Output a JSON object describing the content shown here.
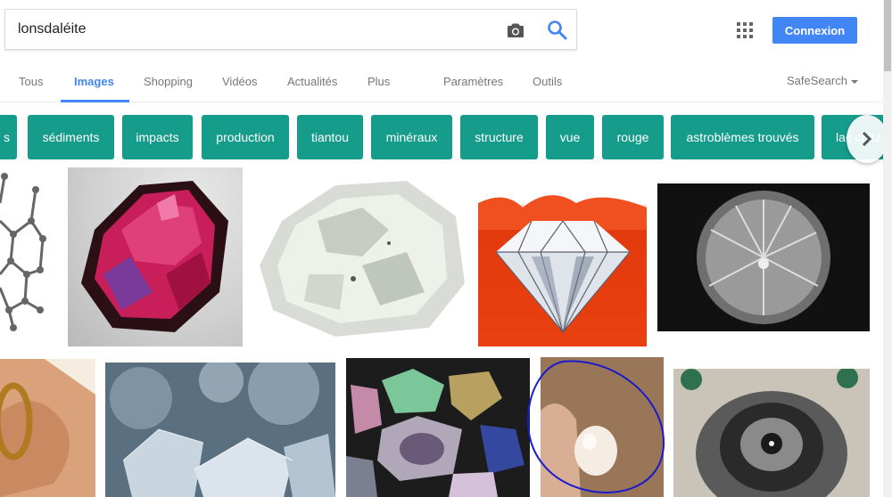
{
  "search": {
    "query": "lonsdaléite"
  },
  "header": {
    "signin_label": "Connexion"
  },
  "tabs": [
    {
      "label": "Tous"
    },
    {
      "label": "Images"
    },
    {
      "label": "Shopping"
    },
    {
      "label": "Vidéos"
    },
    {
      "label": "Actualités"
    },
    {
      "label": "Plus"
    },
    {
      "label": "Paramètres"
    },
    {
      "label": "Outils"
    }
  ],
  "safesearch": {
    "label": "SafeSearch"
  },
  "chips": [
    {
      "label": "s"
    },
    {
      "label": "sédiments"
    },
    {
      "label": "impacts"
    },
    {
      "label": "production"
    },
    {
      "label": "tiantou"
    },
    {
      "label": "minéraux"
    },
    {
      "label": "structure"
    },
    {
      "label": "vue"
    },
    {
      "label": "rouge"
    },
    {
      "label": "astroblèmes trouvés"
    },
    {
      "label": "lac chitz"
    }
  ],
  "colors": {
    "accent": "#4285f4",
    "chip": "#169c8b",
    "tab_text": "#777777"
  },
  "icons": [
    "camera-icon",
    "search-icon",
    "apps-grid-icon",
    "chevron-right-icon",
    "caret-down-icon"
  ]
}
